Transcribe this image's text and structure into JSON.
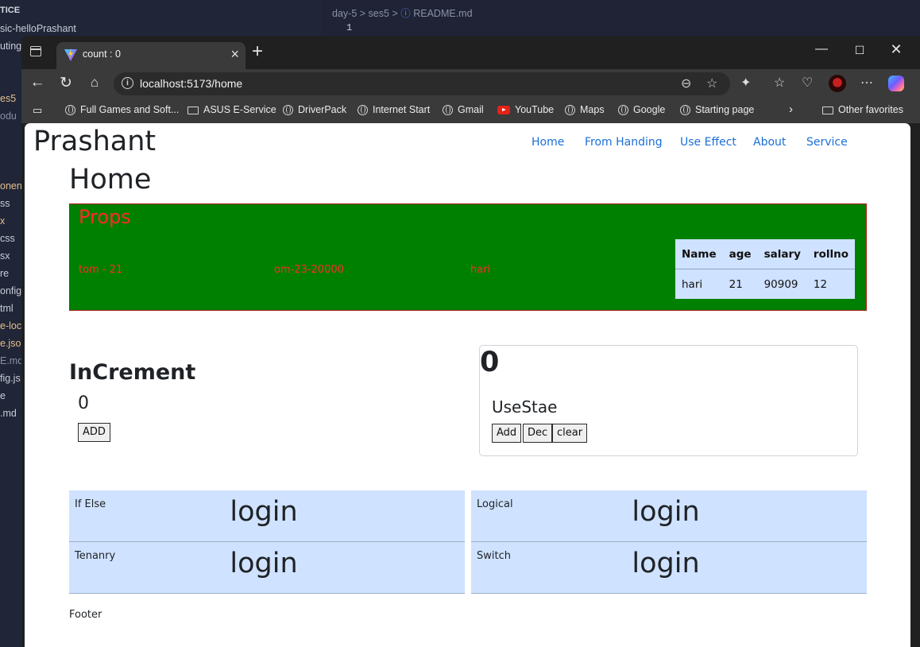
{
  "vscode": {
    "breadcrumb": [
      "day-5",
      "ses5",
      "README.md"
    ],
    "line_number": "1",
    "explorer_items": [
      "TICE",
      "sic-helloPrashant",
      "uting",
      "es5",
      "odu",
      "onen",
      "ss",
      "x",
      "css",
      "sx",
      "re",
      "onfig",
      "tml",
      "e-loc",
      "e.json",
      "E.md",
      "fig.js",
      "e",
      ".md"
    ]
  },
  "browser": {
    "tab_title": "count : 0",
    "url": "localhost:5173/home",
    "favorites": [
      "Full Games and Soft...",
      "ASUS E-Service",
      "DriverPack",
      "Internet Start",
      "Gmail",
      "YouTube",
      "Maps",
      "Google",
      "Starting page"
    ],
    "other_favorites": "Other favorites"
  },
  "page": {
    "brand": "Prashant",
    "nav": [
      "Home",
      "From Handing",
      "Use Effect",
      "About",
      "Service"
    ],
    "heading": "Home",
    "props": {
      "title": "Props",
      "items": [
        "tom - 21",
        "om-23-20000",
        "hari"
      ],
      "table": {
        "headers": [
          "Name",
          "age",
          "salary",
          "rollno"
        ],
        "rows": [
          [
            "hari",
            "21",
            "90909",
            "12"
          ]
        ]
      }
    },
    "increment": {
      "heading": "InCrement",
      "count": "0",
      "add_label": "ADD"
    },
    "usestate": {
      "count": "0",
      "title": "UseStae",
      "buttons": [
        "Add",
        "Dec",
        "clear"
      ]
    },
    "conditionals": [
      {
        "label": "If Else",
        "value": "login"
      },
      {
        "label": "Logical",
        "value": "login"
      },
      {
        "label": "Tenanry",
        "value": "login"
      },
      {
        "label": "Switch",
        "value": "login"
      }
    ],
    "footer": "Footer"
  }
}
